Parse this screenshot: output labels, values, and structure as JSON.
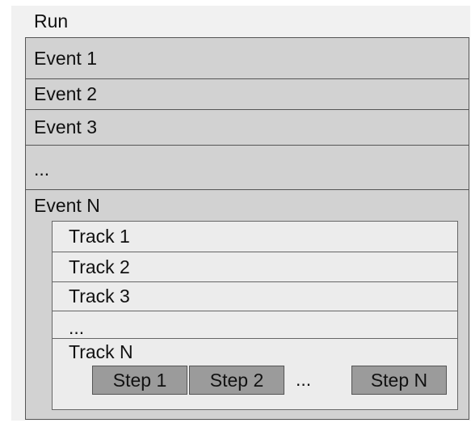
{
  "run": {
    "label": "Run"
  },
  "events": [
    {
      "label": "Event 1"
    },
    {
      "label": "Event 2"
    },
    {
      "label": "Event 3"
    },
    {
      "label": "..."
    }
  ],
  "event_n": {
    "label": "Event N",
    "tracks": [
      {
        "label": "Track 1"
      },
      {
        "label": "Track 2"
      },
      {
        "label": "Track 3"
      },
      {
        "label": "..."
      }
    ],
    "track_n": {
      "label": "Track N",
      "steps": [
        "Step 1",
        "Step 2"
      ],
      "ellipsis": "...",
      "last_step": "Step N"
    }
  }
}
